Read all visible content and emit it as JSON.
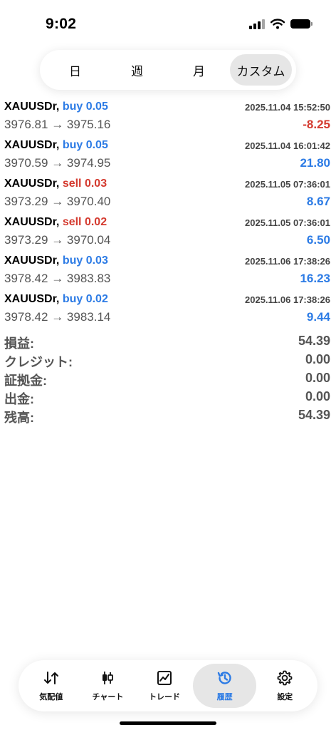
{
  "status_bar": {
    "time": "9:02"
  },
  "period_tabs": [
    {
      "label": "日",
      "active": false
    },
    {
      "label": "週",
      "active": false
    },
    {
      "label": "月",
      "active": false
    },
    {
      "label": "カスタム",
      "active": true
    }
  ],
  "trades": [
    {
      "symbol": "XAUUSDr,",
      "side": "buy",
      "volume_label": "buy 0.05",
      "time": "2025.11.04 15:52:50",
      "open_price": "3976.81",
      "close_price": "3975.16",
      "arrow": "→",
      "profit": "-8.25"
    },
    {
      "symbol": "XAUUSDr,",
      "side": "buy",
      "volume_label": "buy 0.05",
      "time": "2025.11.04 16:01:42",
      "open_price": "3970.59",
      "close_price": "3974.95",
      "arrow": "→",
      "profit": "21.80"
    },
    {
      "symbol": "XAUUSDr,",
      "side": "sell",
      "volume_label": "sell 0.03",
      "time": "2025.11.05 07:36:01",
      "open_price": "3973.29",
      "close_price": "3970.40",
      "arrow": "→",
      "profit": "8.67"
    },
    {
      "symbol": "XAUUSDr,",
      "side": "sell",
      "volume_label": "sell 0.02",
      "time": "2025.11.05 07:36:01",
      "open_price": "3973.29",
      "close_price": "3970.04",
      "arrow": "→",
      "profit": "6.50"
    },
    {
      "symbol": "XAUUSDr,",
      "side": "buy",
      "volume_label": "buy 0.03",
      "time": "2025.11.06 17:38:26",
      "open_price": "3978.42",
      "close_price": "3983.83",
      "arrow": "→",
      "profit": "16.23"
    },
    {
      "symbol": "XAUUSDr,",
      "side": "buy",
      "volume_label": "buy 0.02",
      "time": "2025.11.06 17:38:26",
      "open_price": "3978.42",
      "close_price": "3983.14",
      "arrow": "→",
      "profit": "9.44"
    }
  ],
  "summary": [
    {
      "label": "損益:",
      "value": "54.39"
    },
    {
      "label": "クレジット:",
      "value": "0.00"
    },
    {
      "label": "証拠金:",
      "value": "0.00"
    },
    {
      "label": "出金:",
      "value": "0.00"
    },
    {
      "label": "残高:",
      "value": "54.39"
    }
  ],
  "tab_bar": [
    {
      "label": "気配値",
      "icon": "quotes-icon",
      "active": false
    },
    {
      "label": "チャート",
      "icon": "candlestick-chart-icon",
      "active": false
    },
    {
      "label": "トレード",
      "icon": "trade-chart-icon",
      "active": false
    },
    {
      "label": "履歴",
      "icon": "history-icon",
      "active": true
    },
    {
      "label": "設定",
      "icon": "gear-icon",
      "active": false
    }
  ],
  "colors": {
    "buy": "#2c7be5",
    "sell": "#d43a2f",
    "profit_positive": "#2c7be5",
    "profit_negative": "#d43a2f",
    "active_tab_bg": "#e6e6e6"
  }
}
